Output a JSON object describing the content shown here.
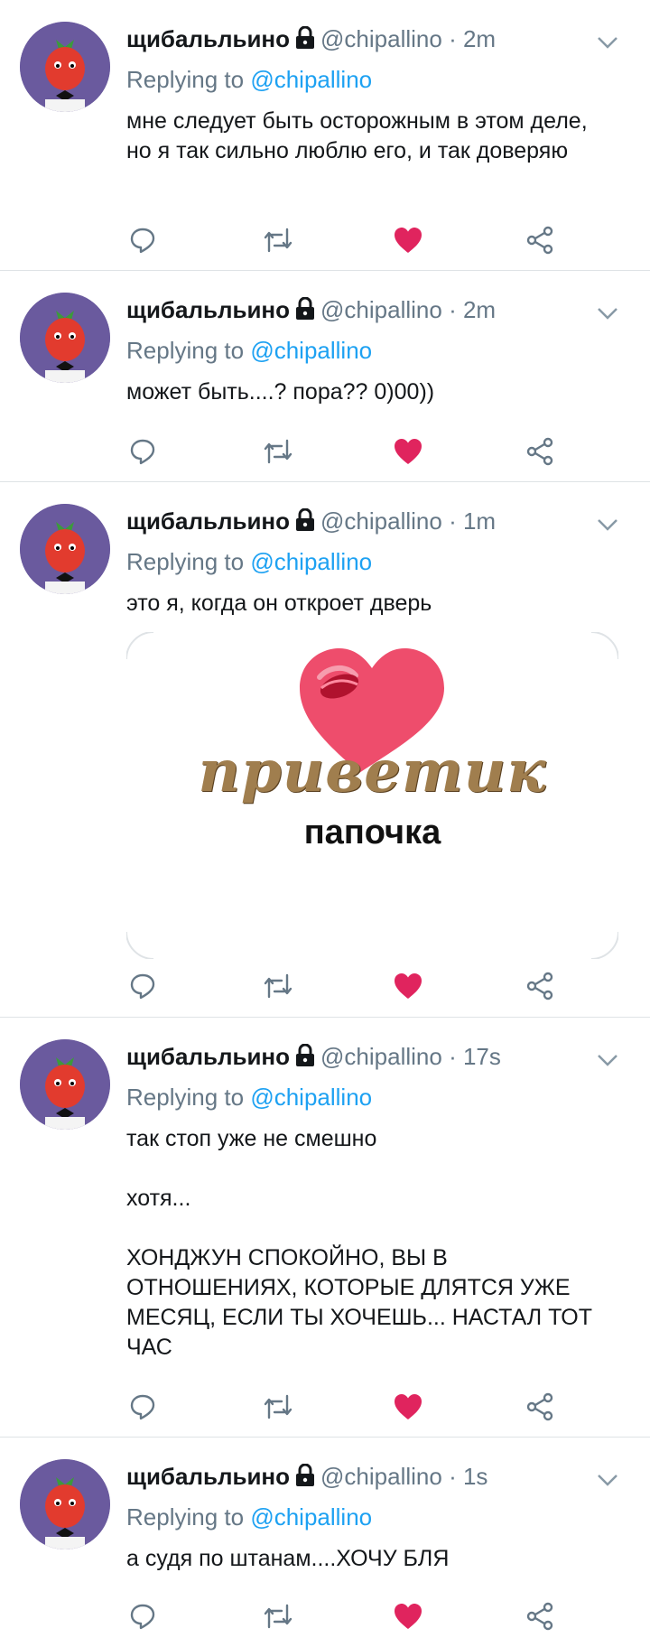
{
  "tweets": [
    {
      "author": "щибальльино",
      "handle": "@chipallino",
      "separator": "·",
      "time": "2m",
      "reply_prefix": "Replying to",
      "reply_to": "@chipallino",
      "lines": [
        "мне следует быть осторожным в этом деле, но я так сильно люблю его, и так доверяю"
      ]
    },
    {
      "author": "щибальльино",
      "handle": "@chipallino",
      "separator": "·",
      "time": "2m",
      "reply_prefix": "Replying to",
      "reply_to": "@chipallino",
      "lines": [
        "может быть....? пора?? 0)00))"
      ]
    },
    {
      "author": "щибальльино",
      "handle": "@chipallino",
      "separator": "·",
      "time": "1m",
      "reply_prefix": "Replying to",
      "reply_to": "@chipallino",
      "lines": [
        "это я, когда он откроет дверь"
      ],
      "media": {
        "line1": "приветик",
        "line2": "папочка"
      }
    },
    {
      "author": "щибальльино",
      "handle": "@chipallino",
      "separator": "·",
      "time": "17s",
      "reply_prefix": "Replying to",
      "reply_to": "@chipallino",
      "lines": [
        "так стоп уже не смешно",
        "хотя...",
        "ХОНДЖУН СПОКОЙНО, ВЫ В ОТНОШЕНИЯХ, КОТОРЫЕ ДЛЯТСЯ УЖЕ МЕСЯЦ, ЕСЛИ ТЫ ХОЧЕШЬ... НАСТАЛ ТОТ ЧАС"
      ]
    },
    {
      "author": "щибальльино",
      "handle": "@chipallino",
      "separator": "·",
      "time": "1s",
      "reply_prefix": "Replying to",
      "reply_to": "@chipallino",
      "lines": [
        "а судя по штанам....ХОЧУ БЛЯ"
      ]
    }
  ],
  "colors": {
    "like": "#e0245e",
    "icon": "#657786",
    "link": "#1da1f2",
    "avatar_bg": "#6a5a9e"
  },
  "icons": {
    "reply": "reply-icon",
    "retweet": "retweet-icon",
    "like": "heart-icon",
    "share": "share-icon",
    "lock": "lock-icon",
    "chevron": "chevron-down-icon"
  }
}
